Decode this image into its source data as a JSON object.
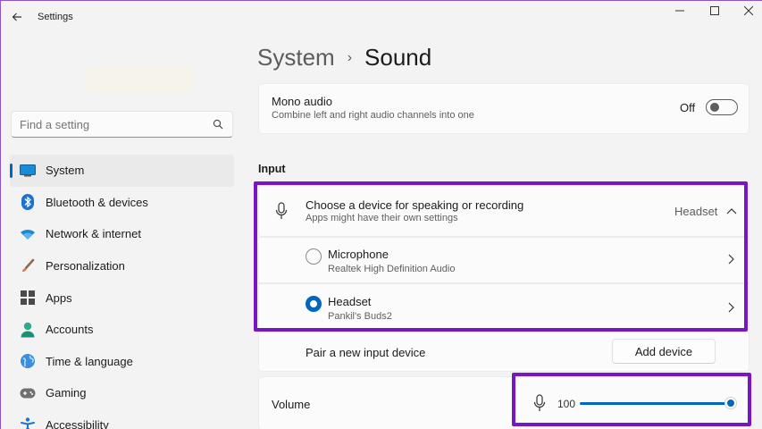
{
  "window": {
    "title": "Settings",
    "controls": {
      "minimize": "minimize-icon",
      "maximize": "maximize-icon",
      "close": "close-icon"
    }
  },
  "sidebar": {
    "search": {
      "placeholder": "Find a setting"
    },
    "items": [
      {
        "label": "System",
        "icon": "system-icon",
        "active": true
      },
      {
        "label": "Bluetooth & devices",
        "icon": "bluetooth-icon"
      },
      {
        "label": "Network & internet",
        "icon": "wifi-icon"
      },
      {
        "label": "Personalization",
        "icon": "brush-icon"
      },
      {
        "label": "Apps",
        "icon": "apps-icon"
      },
      {
        "label": "Accounts",
        "icon": "accounts-icon"
      },
      {
        "label": "Time & language",
        "icon": "globe-icon"
      },
      {
        "label": "Gaming",
        "icon": "gamepad-icon"
      },
      {
        "label": "Accessibility",
        "icon": "accessibility-icon"
      }
    ]
  },
  "breadcrumb": {
    "parent": "System",
    "separator": "›",
    "current": "Sound"
  },
  "mono_audio": {
    "title": "Mono audio",
    "description": "Combine left and right audio channels into one",
    "state_label": "Off",
    "enabled": false
  },
  "input": {
    "section_label": "Input",
    "chooser": {
      "title": "Choose a device for speaking or recording",
      "description": "Apps might have their own settings",
      "selected": "Headset"
    },
    "devices": [
      {
        "name": "Microphone",
        "detail": "Realtek High Definition Audio",
        "selected": false
      },
      {
        "name": "Headset",
        "detail": "Pankil's Buds2",
        "selected": true
      }
    ],
    "pair": {
      "label": "Pair a new input device",
      "button": "Add device"
    },
    "volume": {
      "label": "Volume",
      "value": "100",
      "level": 1.0
    }
  },
  "colors": {
    "accent": "#0067c0",
    "highlight": "#7716c2"
  }
}
